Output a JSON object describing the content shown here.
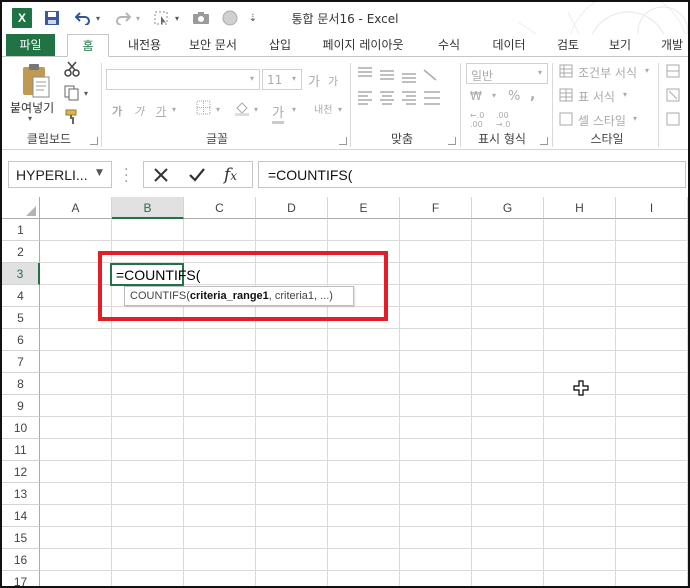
{
  "titlebar": {
    "app_icon": "X",
    "title": "통합 문서16 - Excel"
  },
  "quick_access": {
    "icons": [
      "excel-logo-icon",
      "save-icon",
      "undo-icon",
      "redo-icon",
      "select-icon",
      "camera-icon",
      "circle-icon",
      "customize-icon"
    ]
  },
  "ribbon_tabs": [
    "파일",
    "홈",
    "내전용",
    "보안 문서",
    "삽입",
    "페이지 레이아웃",
    "수식",
    "데이터",
    "검토",
    "보기",
    "개발"
  ],
  "ribbon": {
    "clipboard": {
      "paste_label": "붙여넣기",
      "group_label": "클립보드"
    },
    "font": {
      "font_name": "",
      "font_size": "11",
      "bold": "가",
      "italic": "가",
      "underline": "가",
      "grow": "가",
      "shrink": "가",
      "phonetic": "내천",
      "group_label": "글꼴"
    },
    "alignment": {
      "group_label": "맞춤"
    },
    "number": {
      "format": "일반",
      "group_label": "표시 형식",
      "currency": "₩",
      "percent": "%",
      "comma": ","
    },
    "styles": {
      "conditional": "조건부 서식",
      "table": "표 서식",
      "cell": "셀 스타일",
      "group_label": "스타일"
    }
  },
  "formula_bar": {
    "name_box": "HYPERLI...",
    "formula": "=COUNTIFS("
  },
  "grid": {
    "columns": [
      "A",
      "B",
      "C",
      "D",
      "E",
      "F",
      "G",
      "H",
      "I"
    ],
    "rows": [
      "1",
      "2",
      "3",
      "4",
      "5",
      "6",
      "7",
      "8",
      "9",
      "10",
      "11",
      "12",
      "13",
      "14",
      "15",
      "16",
      "17"
    ],
    "active_cell_text": "=COUNTIFS(",
    "tooltip_fn": "COUNTIFS(",
    "tooltip_bold": "criteria_range1",
    "tooltip_rest": ", criteria1, ...)"
  },
  "colors": {
    "accent": "#217346",
    "highlight": "#e21f26"
  }
}
